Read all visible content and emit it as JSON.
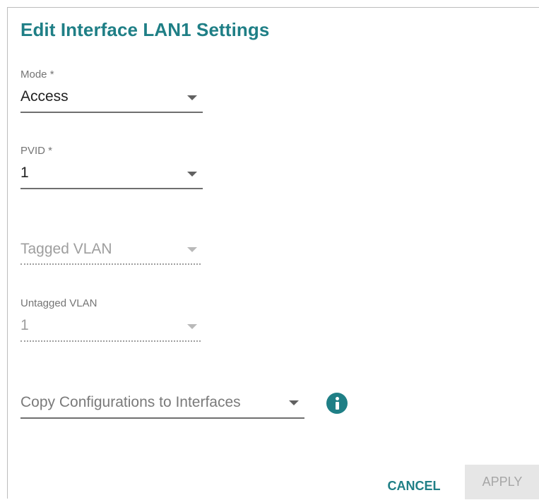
{
  "dialog": {
    "title": "Edit Interface LAN1 Settings"
  },
  "fields": {
    "mode": {
      "label": "Mode *",
      "value": "Access"
    },
    "pvid": {
      "label": "PVID *",
      "value": "1"
    },
    "tagged_vlan": {
      "placeholder": "Tagged VLAN"
    },
    "untagged_vlan": {
      "label": "Untagged VLAN",
      "value": "1"
    },
    "copy_config": {
      "placeholder": "Copy Configurations to Interfaces"
    }
  },
  "icons": {
    "info": "info-icon",
    "dropdown": "caret-down-icon"
  },
  "buttons": {
    "cancel": "CANCEL",
    "apply": "APPLY"
  },
  "colors": {
    "accent": "#1f7f86",
    "disabled_button_bg": "#e6e6e6"
  }
}
